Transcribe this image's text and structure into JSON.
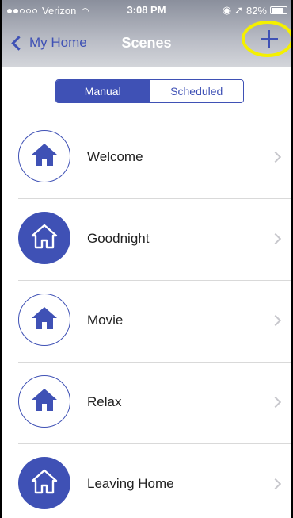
{
  "status_bar": {
    "carrier": "Verizon",
    "time": "3:08 PM",
    "battery": "82%",
    "battery_level": 0.82
  },
  "nav": {
    "back_label": "My Home",
    "title": "Scenes",
    "add_icon": "plus-icon",
    "highlight_color": "#f4f000"
  },
  "tabs": [
    {
      "label": "Manual",
      "active": true
    },
    {
      "label": "Scheduled",
      "active": false
    }
  ],
  "scenes": [
    {
      "name": "Welcome",
      "icon": "home-icon",
      "style": "outline"
    },
    {
      "name": "Goodnight",
      "icon": "home-outline-icon",
      "style": "filled"
    },
    {
      "name": "Movie",
      "icon": "home-icon",
      "style": "outline"
    },
    {
      "name": "Relax",
      "icon": "home-icon",
      "style": "outline"
    },
    {
      "name": "Leaving Home",
      "icon": "home-outline-icon",
      "style": "filled"
    }
  ],
  "colors": {
    "accent": "#3f51b5",
    "separator": "#d9d9d9",
    "chevron": "#c7c7cc"
  }
}
